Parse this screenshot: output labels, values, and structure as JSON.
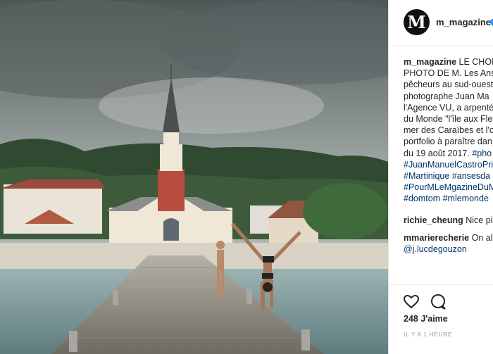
{
  "post": {
    "account": "m_magazine",
    "logo_letter": "M",
    "caption_lines": [
      [
        {
          "t": "m_magazine",
          "bold": true
        },
        {
          "t": " LE CHOIX"
        }
      ],
      [
        {
          "t": "PHOTO DE M. Les Anses"
        }
      ],
      [
        {
          "t": "pêcheurs au sud-ouest"
        }
      ],
      [
        {
          "t": "photographe Juan Ma"
        }
      ],
      [
        {
          "t": "l'Agence VU, a arpenté"
        }
      ],
      [
        {
          "t": "du Monde \"l'île aux Fle"
        }
      ],
      [
        {
          "t": "mer des Caraïbes et l'o"
        }
      ],
      [
        {
          "t": "portfolio à paraître dan"
        }
      ],
      [
        {
          "t": "du 19 août 2017. "
        },
        {
          "t": "#pho",
          "tag": true
        }
      ],
      [
        {
          "t": "#JuanManuelCastroPri",
          "tag": true
        }
      ],
      [
        {
          "t": "#Martinique #ansesda",
          "tag": true
        }
      ],
      [
        {
          "t": "#PourMLeMgazineDuM",
          "tag": true
        }
      ],
      [
        {
          "t": "#domtom #mlemonde",
          "tag": true
        }
      ]
    ],
    "comments": [
      {
        "user": "richie_cheung",
        "text": "Nice pic"
      },
      {
        "user": "mmarierecherie",
        "text": "On allait",
        "mention": "@j.lucdegouzon"
      }
    ],
    "likes": "248 J'aime",
    "time": "IL Y A 1 HEURE",
    "icons": [
      "heart-icon",
      "comment-icon"
    ],
    "colors": {
      "accent_link": "#003569",
      "verified": "#3897f0",
      "text": "#262626",
      "muted": "#999999"
    }
  }
}
